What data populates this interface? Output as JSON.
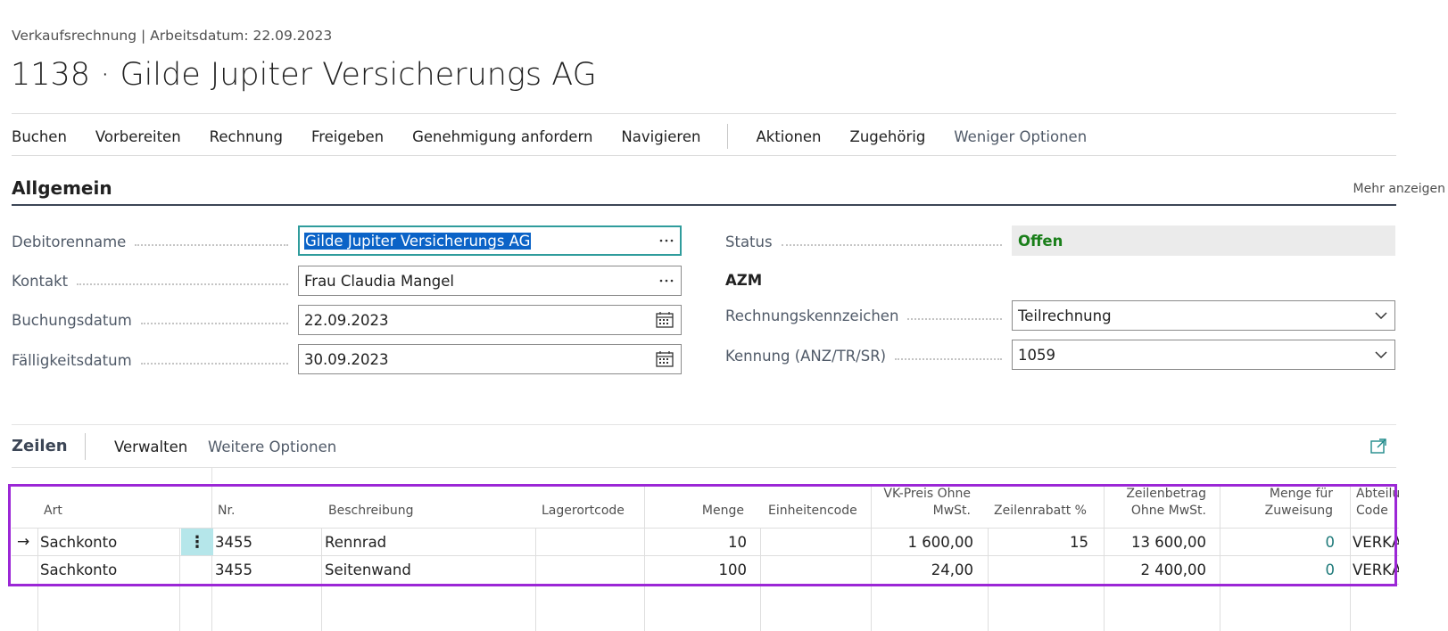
{
  "header": {
    "breadcrumb": "Verkaufsrechnung | Arbeitsdatum: 22.09.2023",
    "title": "1138 · Gilde Jupiter Versicherungs AG"
  },
  "actions": {
    "primary": [
      "Buchen",
      "Vorbereiten",
      "Rechnung",
      "Freigeben",
      "Genehmigung anfordern",
      "Navigieren"
    ],
    "secondary": [
      "Aktionen",
      "Zugehörig"
    ],
    "less_options": "Weniger Optionen"
  },
  "general": {
    "title": "Allgemein",
    "show_more": "Mehr anzeigen",
    "customer_name": {
      "label": "Debitorenname",
      "value": "Gilde Jupiter Versicherungs AG",
      "icon": "ellipsis-icon"
    },
    "contact": {
      "label": "Kontakt",
      "value": "Frau Claudia Mangel",
      "icon": "ellipsis-icon"
    },
    "posting_date": {
      "label": "Buchungsdatum",
      "value": "22.09.2023",
      "icon": "calendar-icon"
    },
    "due_date": {
      "label": "Fälligkeitsdatum",
      "value": "30.09.2023",
      "icon": "calendar-icon"
    },
    "status": {
      "label": "Status",
      "value": "Offen",
      "color": "#1a7f1a"
    },
    "azm": "AZM",
    "invoice_flag": {
      "label": "Rechnungskennzeichen",
      "value": "Teilrechnung"
    },
    "identifier": {
      "label": "Kennung (ANZ/TR/SR)",
      "value": "1059"
    }
  },
  "lines": {
    "title": "Zeilen",
    "manage": "Verwalten",
    "more_options": "Weitere Optionen",
    "columns": {
      "art": "Art",
      "nr": "Nr.",
      "beschreibung": "Beschreibung",
      "lagerortcode": "Lagerortcode",
      "menge": "Menge",
      "einheitencode": "Einheitencode",
      "vk_preis_1": "VK-Preis Ohne",
      "vk_preis_2": "MwSt.",
      "zeilenrabatt": "Zeilenrabatt %",
      "zeilenbetrag_1": "Zeilenbetrag",
      "zeilenbetrag_2": "Ohne MwSt.",
      "menge_zuweisung_1": "Menge für",
      "menge_zuweisung_2": "Zuweisung",
      "abteilung_1": "Abteilu",
      "abteilung_2": "Code"
    },
    "rows": [
      {
        "art": "Sachkonto",
        "nr": "3455",
        "beschreibung": "Rennrad",
        "lagerortcode": "",
        "menge": "10",
        "einheitencode": "",
        "vk_preis": "1 600,00",
        "zeilenrabatt": "15",
        "zeilenbetrag": "13 600,00",
        "menge_zuweisung": "0",
        "abteilung": "VERKA"
      },
      {
        "art": "Sachkonto",
        "nr": "3455",
        "beschreibung": "Seitenwand",
        "lagerortcode": "",
        "menge": "100",
        "einheitencode": "",
        "vk_preis": "24,00",
        "zeilenrabatt": "",
        "zeilenbetrag": "2 400,00",
        "menge_zuweisung": "0",
        "abteilung": "VERKA"
      }
    ]
  },
  "colors": {
    "accent": "#2f9c9c",
    "highlight_box": "#9b27d6",
    "status_green": "#1a7f1a",
    "row_menu_bg": "#b5e6ea"
  }
}
